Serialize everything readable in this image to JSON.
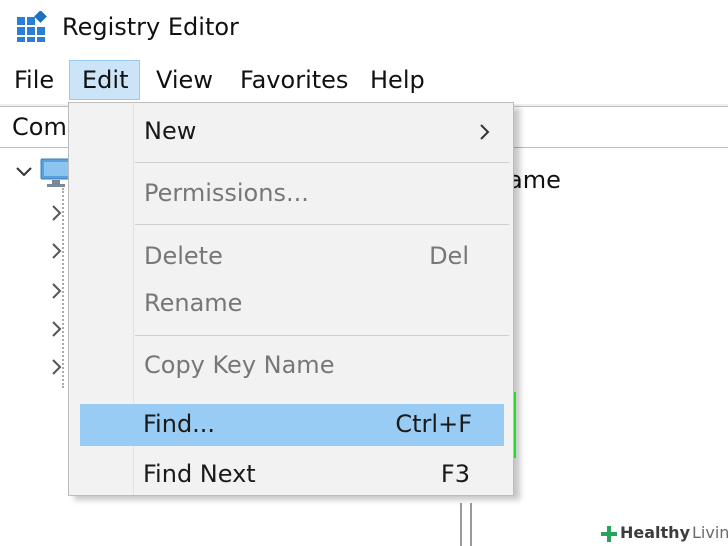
{
  "window": {
    "title": "Registry Editor",
    "icon": "registry-editor-icon"
  },
  "menubar": {
    "items": [
      {
        "label": "File"
      },
      {
        "label": "Edit",
        "active": true
      },
      {
        "label": "View"
      },
      {
        "label": "Favorites"
      },
      {
        "label": "Help"
      }
    ]
  },
  "addressbar": {
    "text": "Com"
  },
  "tree": {
    "root_icon": "computer-icon",
    "expander_icon": "chevron-down-icon",
    "child_arrow_icon": "chevron-right-icon"
  },
  "right_pane": {
    "column_name": "ame"
  },
  "edit_menu": {
    "items": [
      {
        "label": "New",
        "shortcut": "",
        "enabled": true,
        "submenu": true
      },
      {
        "label": "Permissions...",
        "shortcut": "",
        "enabled": false
      },
      {
        "label": "Delete",
        "shortcut": "Del",
        "enabled": false
      },
      {
        "label": "Rename",
        "shortcut": "",
        "enabled": false
      },
      {
        "label": "Copy Key Name",
        "shortcut": "",
        "enabled": false
      },
      {
        "label": "Find...",
        "shortcut": "Ctrl+F",
        "enabled": true,
        "highlighted": true
      },
      {
        "label": "Find Next",
        "shortcut": "F3",
        "enabled": true
      }
    ]
  },
  "watermark": {
    "brand": "Healthy",
    "brand2": "Living"
  },
  "colors": {
    "highlight_frame": "#22e02a",
    "selected_item": "#99ccf5",
    "active_menu": "#cce4f7"
  }
}
